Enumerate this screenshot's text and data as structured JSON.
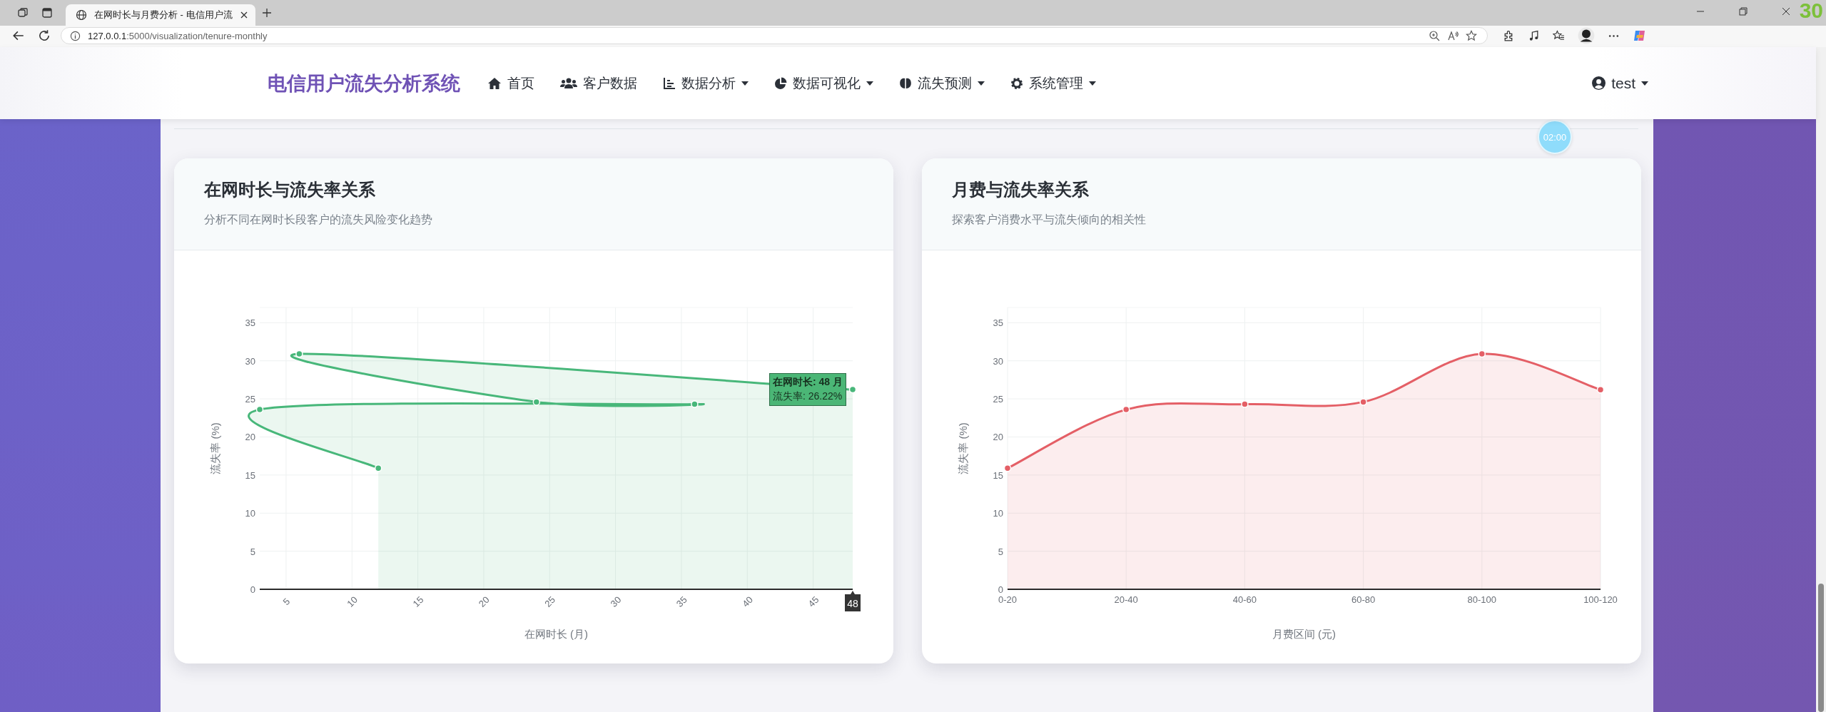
{
  "browser": {
    "tab_title": "在网时长与月费分析 - 电信用户流",
    "url_host": "127.0.0.1",
    "url_path": ":5000/visualization/tenure-monthly"
  },
  "overlay_counter": "30",
  "nav": {
    "brand": "电信用户流失分析系统",
    "items": [
      {
        "label": "首页",
        "dropdown": false
      },
      {
        "label": "客户数据",
        "dropdown": false
      },
      {
        "label": "数据分析",
        "dropdown": true
      },
      {
        "label": "数据可视化",
        "dropdown": true
      },
      {
        "label": "流失预测",
        "dropdown": true
      },
      {
        "label": "系统管理",
        "dropdown": true
      }
    ],
    "user": {
      "label": "test",
      "dropdown": true
    }
  },
  "timer": "02:00",
  "cards": [
    {
      "title": "在网时长与流失率关系",
      "subtitle": "分析不同在网时长段客户的流失风险变化趋势",
      "chart_data": {
        "type": "area",
        "xlabel": "在网时长 (月)",
        "ylabel": "流失率 (%)",
        "x": [
          12,
          3,
          36,
          24,
          6,
          48
        ],
        "series": [
          {
            "color": "#48b77a",
            "values": [
              15.9,
              23.6,
              24.3,
              24.6,
              30.9,
              26.22
            ]
          }
        ],
        "grid": true,
        "xlim": [
          3,
          48
        ],
        "ylim": [
          0,
          37
        ],
        "xticks": [
          5,
          10,
          15,
          20,
          25,
          30,
          35,
          40,
          45
        ],
        "yticks": [
          0,
          5,
          10,
          15,
          20,
          25,
          30,
          35
        ]
      },
      "tooltip": {
        "title": "在网时长: 48 月",
        "text": "流失率: 26.22%"
      },
      "hover_x_label": "48"
    },
    {
      "title": "月费与流失率关系",
      "subtitle": "探索客户消费水平与流失倾向的相关性",
      "chart_data": {
        "type": "area",
        "xlabel": "月费区间 (元)",
        "ylabel": "流失率 (%)",
        "categories": [
          "0-20",
          "20-40",
          "40-60",
          "60-80",
          "80-100",
          "100-120"
        ],
        "series": [
          {
            "color": "#e45f66",
            "values": [
              15.9,
              23.6,
              24.3,
              24.6,
              30.9,
              26.2
            ]
          }
        ],
        "grid": true,
        "ylim": [
          0,
          37
        ],
        "yticks": [
          0,
          5,
          10,
          15,
          20,
          25,
          30,
          35
        ]
      }
    }
  ]
}
